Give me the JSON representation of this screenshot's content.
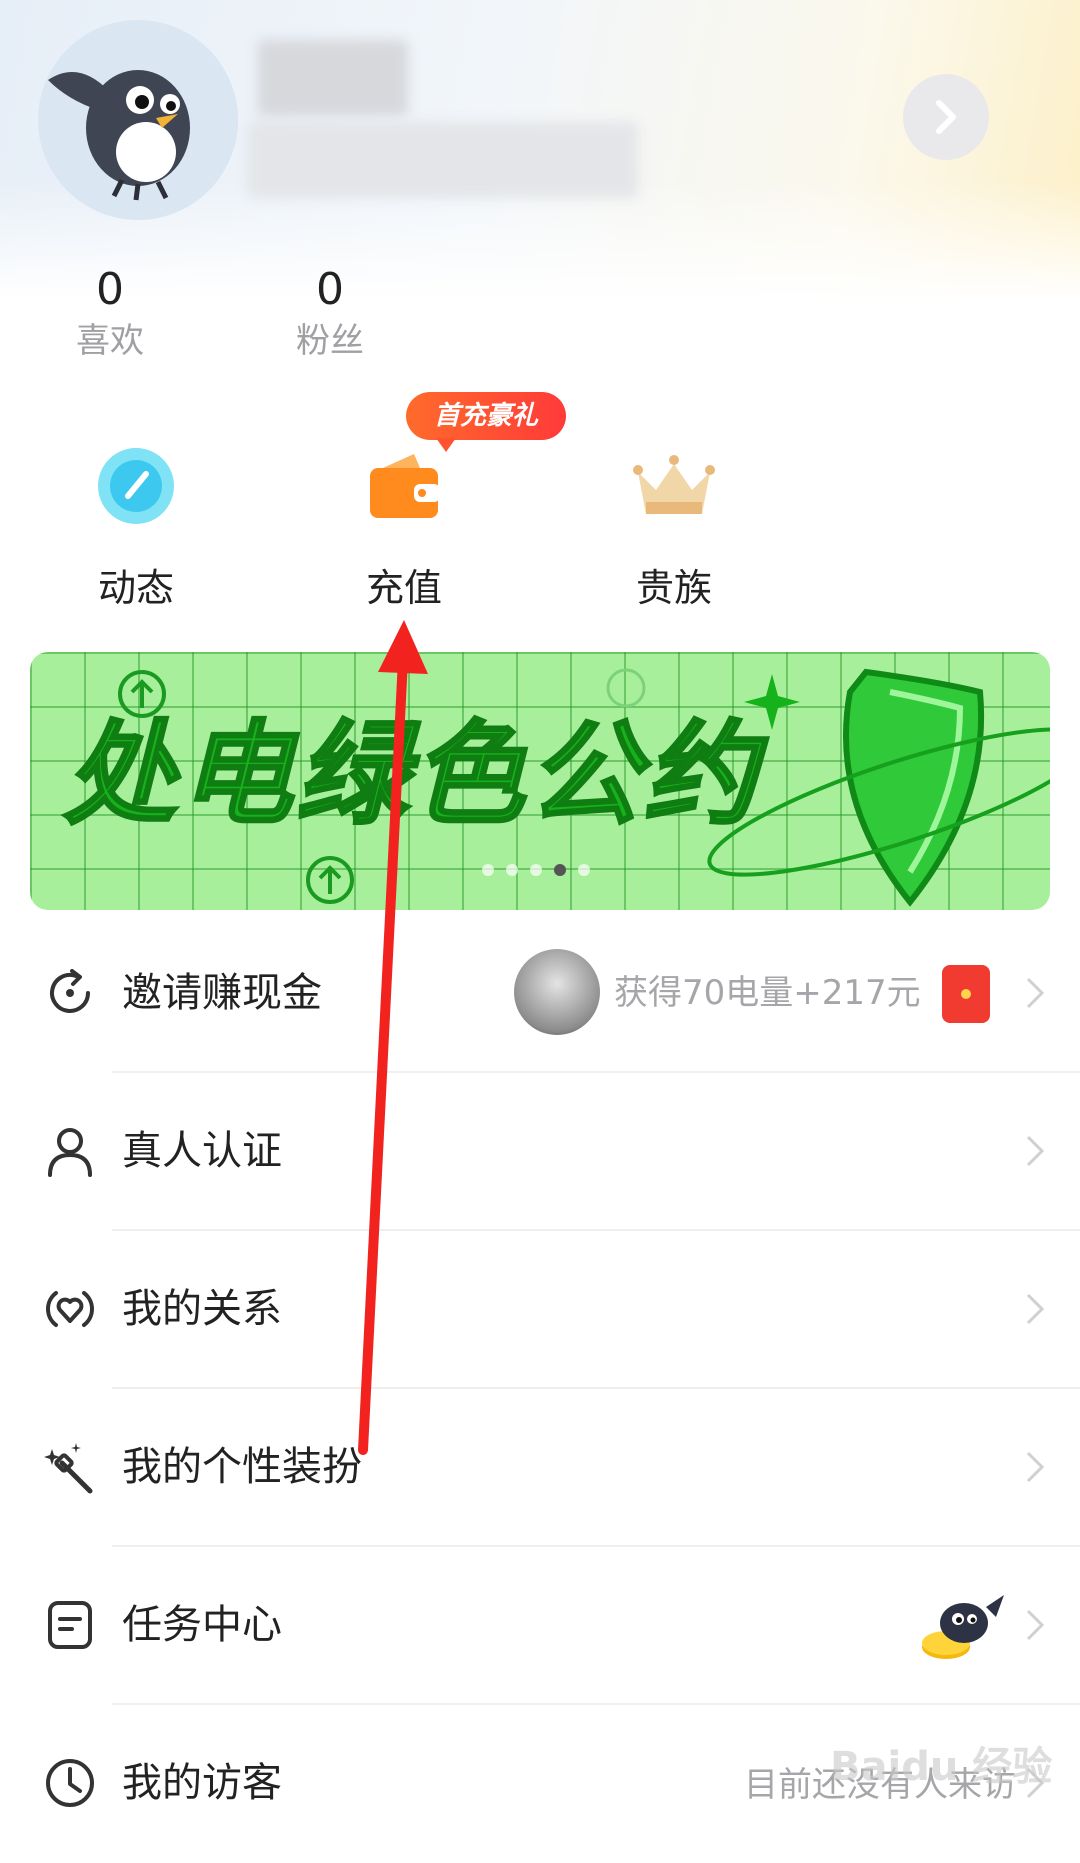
{
  "profile": {
    "stats": [
      {
        "value": "0",
        "label": "喜欢"
      },
      {
        "value": "0",
        "label": "粉丝"
      }
    ]
  },
  "shortcuts": [
    {
      "label": "动态",
      "icon": "activity-icon"
    },
    {
      "label": "充值",
      "icon": "wallet-icon",
      "badge": "首充豪礼"
    },
    {
      "label": "贵族",
      "icon": "crown-icon"
    }
  ],
  "banner": {
    "title": "处电绿色公约",
    "page_count": 5,
    "active_page": 4
  },
  "menu": [
    {
      "label": "邀请赚现金",
      "icon": "refresh-share-icon",
      "extra": "获得70电量+217元"
    },
    {
      "label": "真人认证",
      "icon": "person-icon"
    },
    {
      "label": "我的关系",
      "icon": "heart-relation-icon"
    },
    {
      "label": "我的个性装扮",
      "icon": "magic-wand-icon"
    },
    {
      "label": "任务中心",
      "icon": "task-list-icon"
    },
    {
      "label": "我的访客",
      "icon": "clock-icon",
      "extra": "目前还没有人来访"
    }
  ],
  "watermark": "Baidu 经验",
  "colors": {
    "annotation_arrow": "#f2231f",
    "banner_green": "#16b21b",
    "badge_orange": "#ff6b2b"
  }
}
